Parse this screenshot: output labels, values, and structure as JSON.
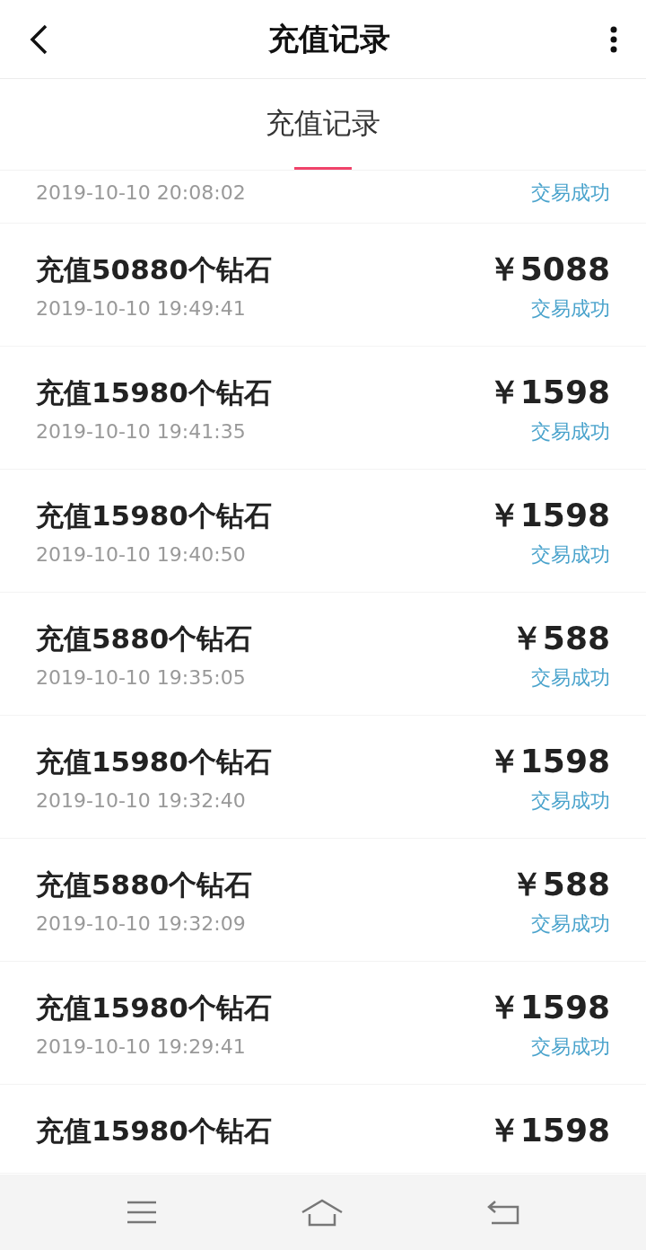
{
  "header": {
    "title": "充值记录"
  },
  "tabs": [
    {
      "label": "充值记录",
      "selected": true
    }
  ],
  "records": [
    {
      "time": "2019-10-10 20:08:02",
      "status": "交易成功"
    },
    {
      "title": "充值50880个钻石",
      "amount": "￥5088",
      "time": "2019-10-10 19:49:41",
      "status": "交易成功"
    },
    {
      "title": "充值15980个钻石",
      "amount": "￥1598",
      "time": "2019-10-10 19:41:35",
      "status": "交易成功"
    },
    {
      "title": "充值15980个钻石",
      "amount": "￥1598",
      "time": "2019-10-10 19:40:50",
      "status": "交易成功"
    },
    {
      "title": "充值5880个钻石",
      "amount": "￥588",
      "time": "2019-10-10 19:35:05",
      "status": "交易成功"
    },
    {
      "title": "充值15980个钻石",
      "amount": "￥1598",
      "time": "2019-10-10 19:32:40",
      "status": "交易成功"
    },
    {
      "title": "充值5880个钻石",
      "amount": "￥588",
      "time": "2019-10-10 19:32:09",
      "status": "交易成功"
    },
    {
      "title": "充值15980个钻石",
      "amount": "￥1598",
      "time": "2019-10-10 19:29:41",
      "status": "交易成功"
    },
    {
      "title": "充值15980个钻石",
      "amount": "￥1598"
    }
  ]
}
